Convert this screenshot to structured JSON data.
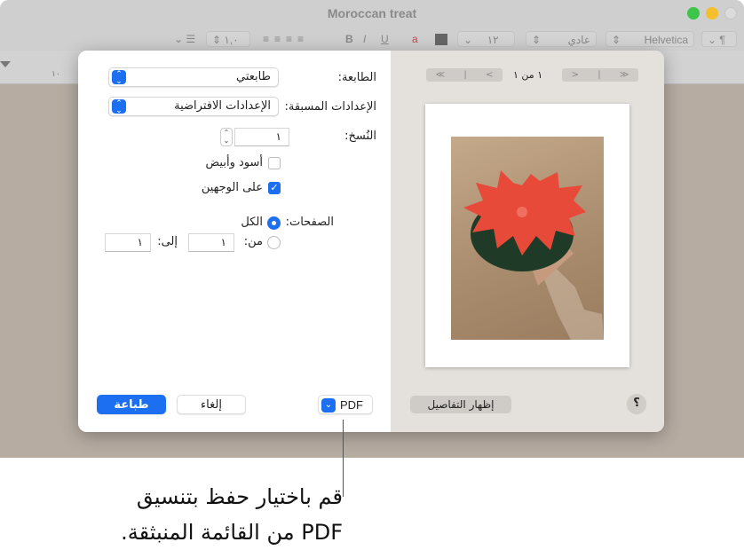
{
  "window": {
    "title": "Moroccan treat"
  },
  "toolbar": {
    "line_spacing": "١,٠",
    "bold": "B",
    "italic": "I",
    "underline": "U",
    "font_size": "١٢",
    "font_style": "عادي",
    "font_family": "Helvetica",
    "paragraph": "¶"
  },
  "ruler": {
    "left_label": "١٠"
  },
  "print_dialog": {
    "printer_label": "الطابعة:",
    "printer_value": "طابعتي",
    "presets_label": "الإعدادات المسبقة:",
    "presets_value": "الإعدادات الافتراضية",
    "copies_label": "النُسخ:",
    "copies_value": "١",
    "bw_label": "أسود وأبيض",
    "bw_checked": false,
    "two_sided_label": "على الوجهين",
    "two_sided_checked": true,
    "pages_label": "الصفحات:",
    "pages_all": "الكل",
    "pages_from": "من:",
    "from_value": "١",
    "pages_to": "إلى:",
    "to_value": "١",
    "pages_selected": "all",
    "page_indicator": "١ من ١",
    "pdf_button": "PDF",
    "cancel_button": "إلغاء",
    "print_button": "طباعة",
    "show_details": "إظهار التفاصيل",
    "help": "؟",
    "accent": "#1d6ff2"
  },
  "callout": {
    "line1": "قم باختيار حفظ بتنسيق",
    "line2": "PDF من القائمة المنبثقة."
  }
}
